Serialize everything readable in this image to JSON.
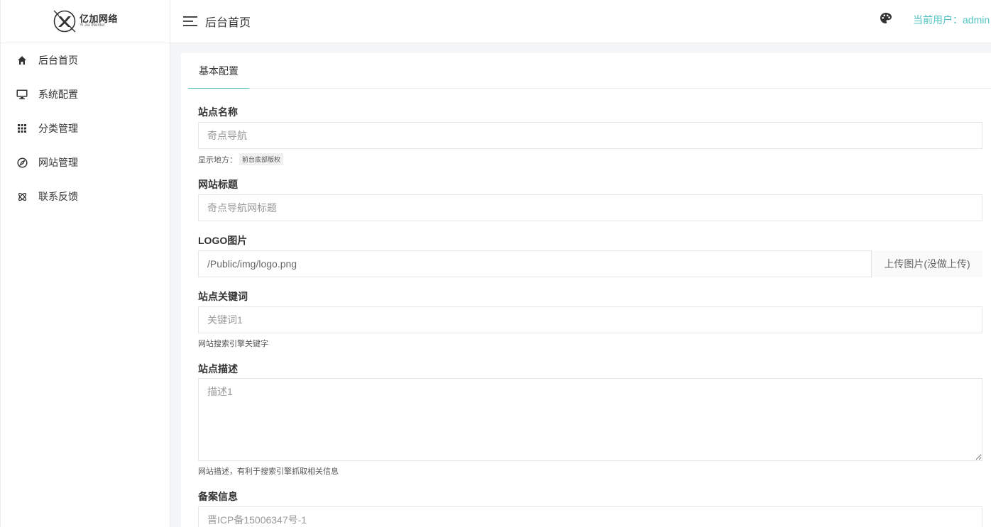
{
  "brand": {
    "name": "亿加网络",
    "sub": "Yi Jia INenter"
  },
  "header": {
    "title": "后台首页",
    "current_user": "当前用户：admin"
  },
  "sidebar": {
    "items": [
      {
        "label": "后台首页",
        "icon": "home-icon"
      },
      {
        "label": "系统配置",
        "icon": "monitor-icon"
      },
      {
        "label": "分类管理",
        "icon": "grid-icon"
      },
      {
        "label": "网站管理",
        "icon": "compass-icon"
      },
      {
        "label": "联系反馈",
        "icon": "atom-icon"
      }
    ]
  },
  "tabs": [
    {
      "label": "基本配置"
    }
  ],
  "form": {
    "site_name": {
      "label": "站点名称",
      "placeholder": "奇点导航",
      "help_prefix": "显示地方：",
      "help_badge": "前台底部版权"
    },
    "site_title": {
      "label": "网站标题",
      "placeholder": "奇点导航网标题"
    },
    "logo": {
      "label": "LOGO图片",
      "value": "/Public/img/logo.png",
      "upload_label": "上传图片(没做上传)"
    },
    "keywords": {
      "label": "站点关键词",
      "placeholder": "关键词1",
      "help": "网站搜索引擎关键字"
    },
    "description": {
      "label": "站点描述",
      "placeholder": "描述1",
      "help": "网站描述，有利于搜索引擎抓取相关信息"
    },
    "icp": {
      "label": "备案信息",
      "placeholder": "晋ICP备15006347号-1"
    }
  },
  "colors": {
    "accent": "#4fc3c2"
  }
}
